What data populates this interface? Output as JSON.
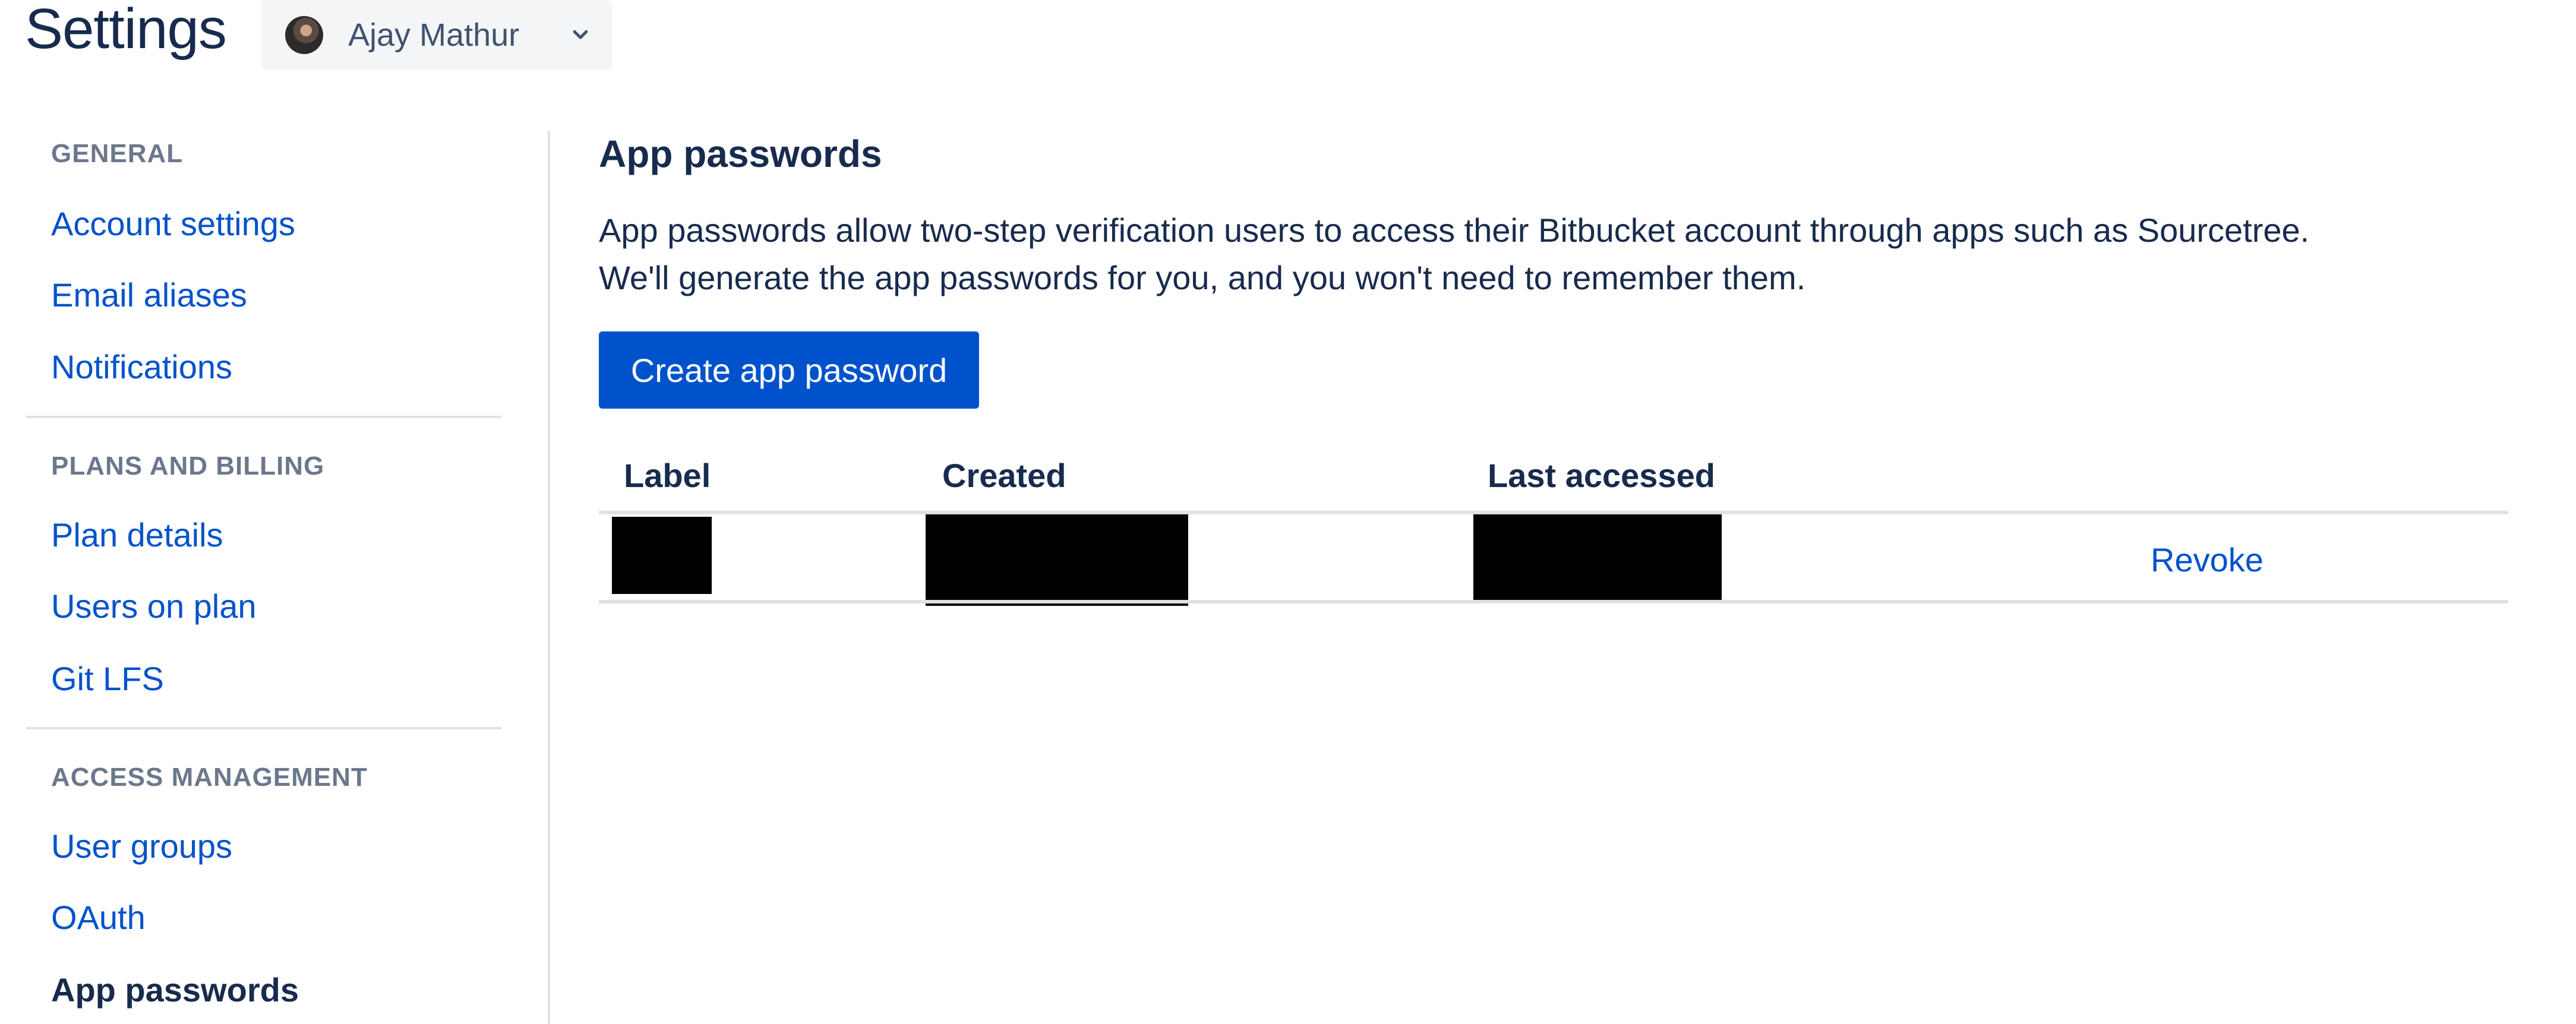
{
  "header": {
    "title": "Settings",
    "account": {
      "name": "Ajay Mathur",
      "avatar_icon": "user-avatar",
      "dropdown_icon": "chevron-down-icon"
    }
  },
  "sidebar": {
    "sections": [
      {
        "heading": "GENERAL",
        "items": [
          {
            "label": "Account settings",
            "active": false
          },
          {
            "label": "Email aliases",
            "active": false
          },
          {
            "label": "Notifications",
            "active": false
          }
        ]
      },
      {
        "heading": "PLANS AND BILLING",
        "items": [
          {
            "label": "Plan details",
            "active": false
          },
          {
            "label": "Users on plan",
            "active": false
          },
          {
            "label": "Git LFS",
            "active": false
          }
        ]
      },
      {
        "heading": "ACCESS MANAGEMENT",
        "items": [
          {
            "label": "User groups",
            "active": false
          },
          {
            "label": "OAuth",
            "active": false
          },
          {
            "label": "App passwords",
            "active": true
          }
        ]
      }
    ]
  },
  "main": {
    "title": "App passwords",
    "description": [
      "App passwords allow two-step verification users to access their Bitbucket account through apps such as Sourcetree.",
      "We'll generate the app passwords for you, and you won't need to remember them."
    ],
    "create_button_label": "Create app password",
    "table": {
      "columns": [
        "Label",
        "Created",
        "Last accessed",
        ""
      ],
      "rows": [
        {
          "label": "[redacted]",
          "created": "[redacted]",
          "last_accessed": "[redacted]",
          "action": "Revoke"
        }
      ]
    }
  },
  "colors": {
    "link": "#0052cc",
    "primary_button": "#0052cc",
    "text": "#172b4d",
    "muted_heading": "#6b778c",
    "divider": "#dfe1e6",
    "switcher_bg": "#f4f5f7"
  }
}
